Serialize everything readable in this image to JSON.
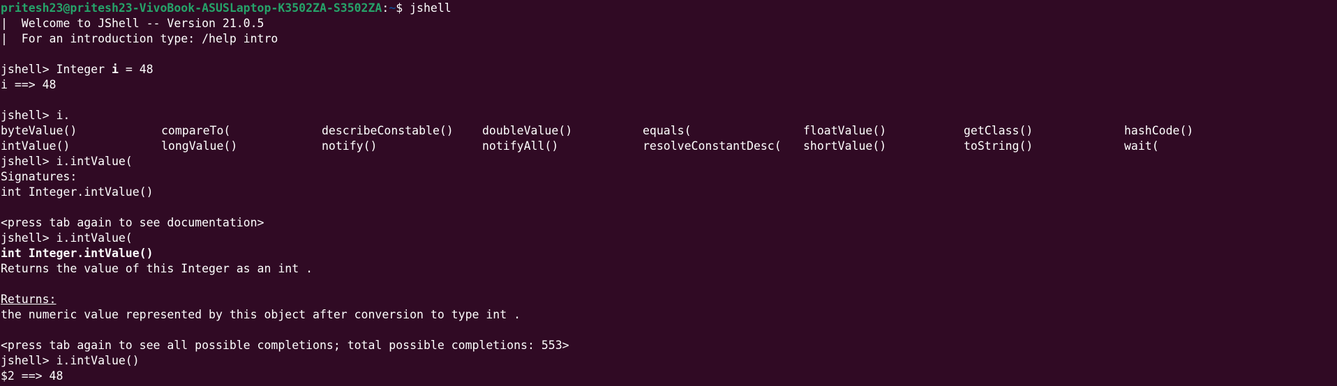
{
  "colors": {
    "background": "#300a24",
    "foreground": "#ffffff",
    "prompt_user": "#26a269",
    "prompt_path": "#12488b"
  },
  "shell_prompt": {
    "user_host": "pritesh23@pritesh23-VivoBook-ASUSLaptop-K3502ZA-S3502ZA",
    "colon": ":",
    "path": "~",
    "tail": "$ jshell"
  },
  "welcome": [
    "|  Welcome to JShell -- Version 21.0.5",
    "|  For an introduction type: /help intro"
  ],
  "cmd1": {
    "pre": "jshell> Integer ",
    "bold": "i",
    "post": " = 48"
  },
  "out1": "i ==> 48",
  "cmd2": "jshell> i.",
  "completions": {
    "row1": [
      "byteValue()",
      "compareTo(",
      "describeConstable()",
      "doubleValue()",
      "equals(",
      "floatValue()",
      "getClass()",
      "hashCode()"
    ],
    "row2": [
      "intValue()",
      "longValue()",
      "notify()",
      "notifyAll()",
      "resolveConstantDesc(",
      "shortValue()",
      "toString()",
      "wait("
    ]
  },
  "cmd3": "jshell> i.intValue(",
  "signatures_label": "Signatures:",
  "signature": "int Integer.intValue()",
  "press_tab_doc": "<press tab again to see documentation>",
  "cmd4": "jshell> i.intValue(",
  "doc_signature": "int Integer.intValue()",
  "doc_description": "Returns the value of this Integer as an int .",
  "returns_label": "Returns:",
  "returns_text": "the numeric value represented by this object after conversion to type int .",
  "press_tab_all": "<press tab again to see all possible completions; total possible completions: 553>",
  "cmd5": "jshell> i.intValue()",
  "out5": "$2 ==> 48"
}
